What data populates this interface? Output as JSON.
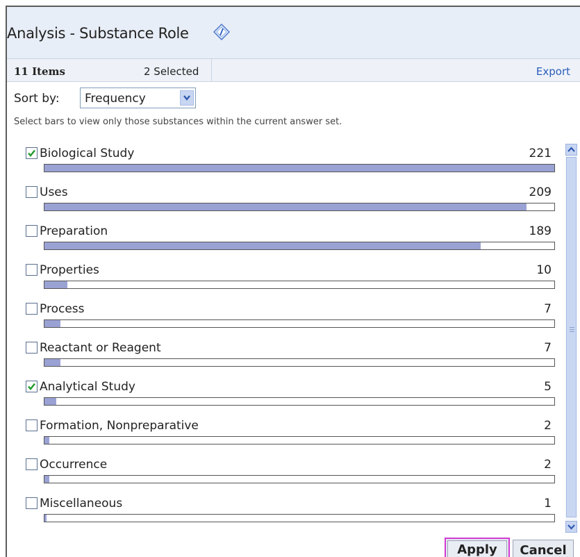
{
  "header": {
    "title": "Analysis - Substance Role",
    "info_icon": "info-diamond-icon"
  },
  "summary": {
    "items_count": "11 Items",
    "selected_count": "2 Selected",
    "export_label": "Export"
  },
  "sort": {
    "label": "Sort by:",
    "selected": "Frequency",
    "arrow_icon": "chevron-down-icon"
  },
  "hint": "Select bars to view only those substances within the current answer set.",
  "bar_color": "#9aa2d4",
  "accent_color": "#d13ad3",
  "max_count": 221,
  "rows": [
    {
      "label": "Biological Study",
      "count": "221",
      "value": 221,
      "checked": true
    },
    {
      "label": "Uses",
      "count": "209",
      "value": 209,
      "checked": false
    },
    {
      "label": "Preparation",
      "count": "189",
      "value": 189,
      "checked": false
    },
    {
      "label": "Properties",
      "count": "10",
      "value": 10,
      "checked": false
    },
    {
      "label": "Process",
      "count": "7",
      "value": 7,
      "checked": false
    },
    {
      "label": "Reactant or Reagent",
      "count": "7",
      "value": 7,
      "checked": false
    },
    {
      "label": "Analytical Study",
      "count": "5",
      "value": 5,
      "checked": true
    },
    {
      "label": "Formation, Nonpreparative",
      "count": "2",
      "value": 2,
      "checked": false
    },
    {
      "label": "Occurrence",
      "count": "2",
      "value": 2,
      "checked": false
    },
    {
      "label": "Miscellaneous",
      "count": "1",
      "value": 1,
      "checked": false
    }
  ],
  "buttons": {
    "apply": "Apply",
    "cancel": "Cancel"
  }
}
